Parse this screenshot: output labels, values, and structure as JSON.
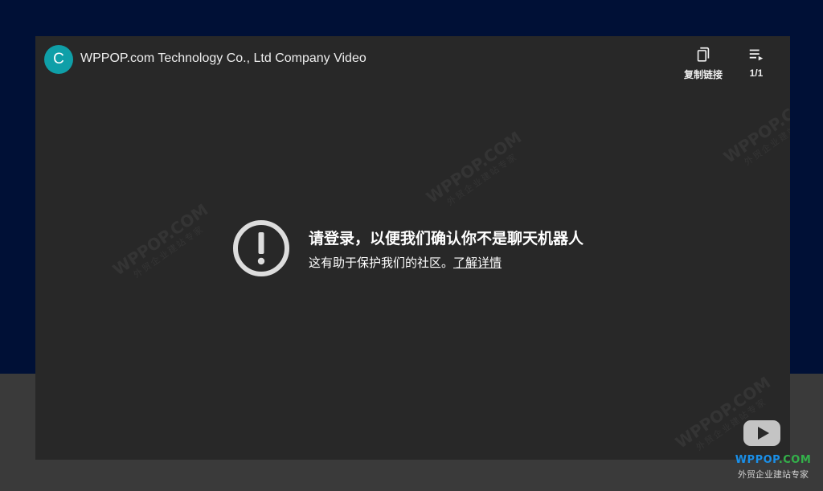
{
  "header": {
    "avatar_letter": "C",
    "title": "WPPOP.com Technology Co., Ltd Company Video",
    "copy_link_label": "复制链接",
    "playlist_count": "1/1"
  },
  "message": {
    "title": "请登录，以便我们确认你不是聊天机器人",
    "subtitle": "这有助于保护我们的社区。",
    "learn_more": "了解详情"
  },
  "brand": {
    "name_main": "WPPOP",
    "name_suffix": ".COM",
    "slogan": "外贸企业建站专家"
  },
  "watermark": {
    "text": "WPPOP.COM",
    "sub": "外贸企业建站专家"
  },
  "colors": {
    "page_top": "#001036",
    "page_bottom": "#3a3a3a",
    "player_bg": "#282828",
    "avatar_bg": "#0f9fa8",
    "brand_blue": "#1a8fe8",
    "brand_green": "#33b14a"
  },
  "icons": {
    "copy": "copy-icon",
    "playlist": "playlist-icon",
    "alert": "alert-circle-icon",
    "youtube": "youtube-logo-icon"
  }
}
